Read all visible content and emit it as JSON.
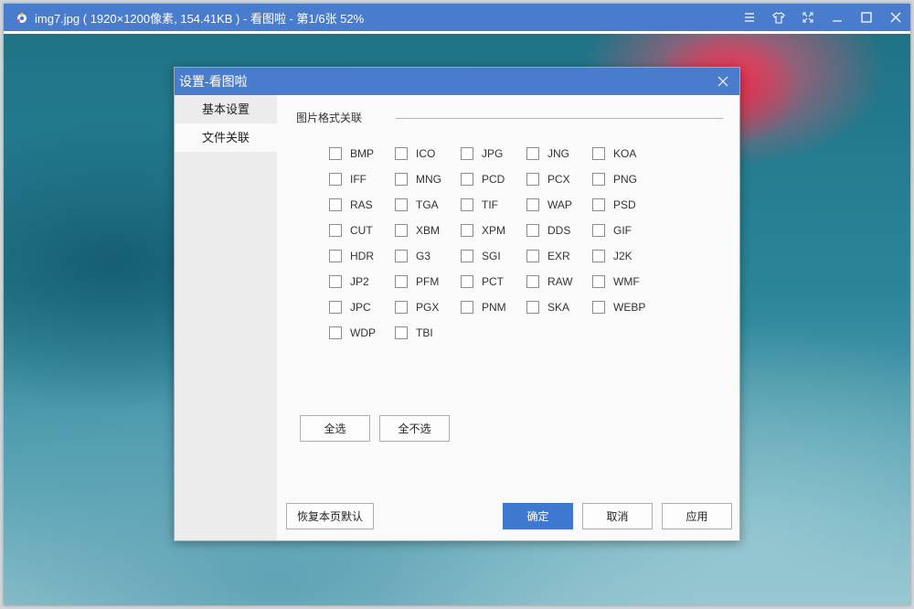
{
  "window": {
    "title": "img7.jpg ( 1920×1200像素, 154.41KB )  - 看图啦 - 第1/6张 52%",
    "accent": "#4a7ccd",
    "controls": [
      "menu-icon",
      "shirt-skin-icon",
      "fullscreen-icon",
      "minimize-icon",
      "maximize-icon",
      "close-icon"
    ]
  },
  "dialog": {
    "title": "设置-看图啦",
    "sidebar": {
      "items": [
        {
          "label": "基本设置",
          "active": false
        },
        {
          "label": "文件关联",
          "active": true
        }
      ]
    },
    "section_title": "图片格式关联",
    "formats": [
      [
        "BMP",
        "ICO",
        "JPG",
        "JNG",
        "KOA"
      ],
      [
        "IFF",
        "MNG",
        "PCD",
        "PCX",
        "PNG"
      ],
      [
        "RAS",
        "TGA",
        "TIF",
        "WAP",
        "PSD"
      ],
      [
        "CUT",
        "XBM",
        "XPM",
        "DDS",
        "GIF"
      ],
      [
        "HDR",
        "G3",
        "SGI",
        "EXR",
        "J2K"
      ],
      [
        "JP2",
        "PFM",
        "PCT",
        "RAW",
        "WMF"
      ],
      [
        "JPC",
        "PGX",
        "PNM",
        "SKA",
        "WEBP"
      ],
      [
        "WDP",
        "TBI"
      ]
    ],
    "buttons": {
      "select_all": "全选",
      "select_none": "全不选",
      "restore_defaults": "恢复本页默认",
      "ok": "确定",
      "cancel": "取消",
      "apply": "应用"
    }
  }
}
